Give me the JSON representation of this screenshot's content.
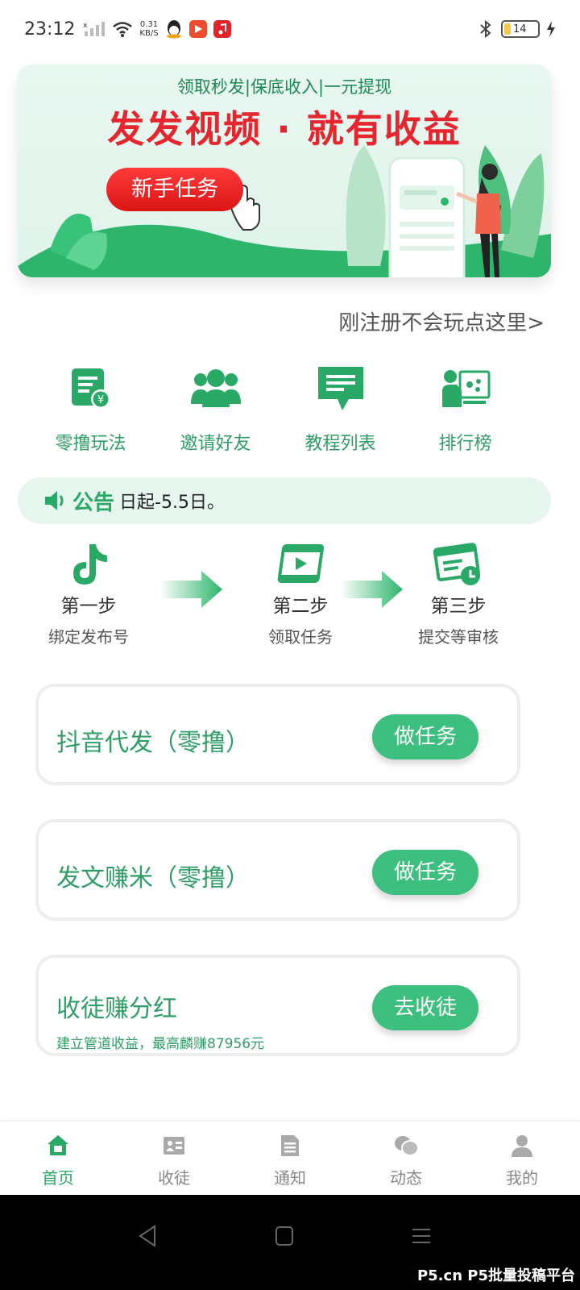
{
  "status_bar": {
    "time": "23:12",
    "net_speed_value": "0.31",
    "net_speed_unit": "KB/S",
    "battery": "14"
  },
  "banner": {
    "subtitle": "领取秒发|保底收入|一元提现",
    "title": "发发视频 · 就有收益",
    "button_label": "新手任务"
  },
  "newbie_link": "刚注册不会玩点这里>",
  "quick_entries": [
    {
      "label": "零撸玩法",
      "icon": "document-yuan-icon"
    },
    {
      "label": "邀请好友",
      "icon": "users-icon"
    },
    {
      "label": "教程列表",
      "icon": "chat-list-icon"
    },
    {
      "label": "排行榜",
      "icon": "ranking-presenter-icon"
    }
  ],
  "notice": {
    "tag": "公告",
    "text": "日起-5.5日。"
  },
  "steps": [
    {
      "title": "第一步",
      "desc": "绑定发布号"
    },
    {
      "title": "第二步",
      "desc": "领取任务"
    },
    {
      "title": "第三步",
      "desc": "提交等审核"
    }
  ],
  "tasks": [
    {
      "title": "抖音代发（零撸）",
      "button": "做任务"
    },
    {
      "title": "发文赚米（零撸）",
      "button": "做任务"
    },
    {
      "title": "收徒赚分红",
      "subtitle": "建立管道收益，最高麟赚87956元",
      "button": "去收徒"
    }
  ],
  "bottom_nav": [
    {
      "label": "首页",
      "active": true
    },
    {
      "label": "收徒",
      "active": false
    },
    {
      "label": "通知",
      "active": false
    },
    {
      "label": "动态",
      "active": false
    },
    {
      "label": "我的",
      "active": false
    }
  ],
  "watermark": "P5.cn P5批量投稿平台",
  "colors": {
    "brand_green": "#2aa866",
    "button_green": "#3cbf7f",
    "banner_red": "#e5262e"
  }
}
